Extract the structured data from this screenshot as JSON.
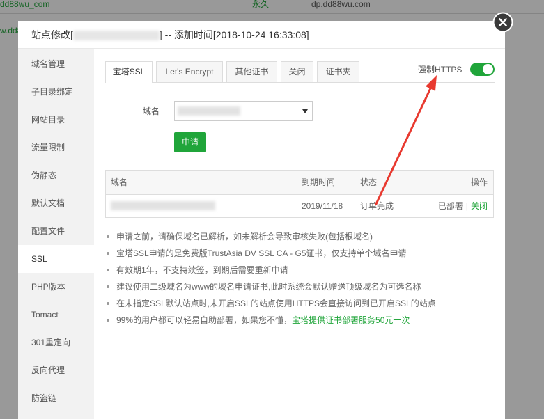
{
  "background_page": {
    "row1": {
      "site": "dd88wu_com",
      "expiry": "永久",
      "domain": "dp.dd88wu.com"
    },
    "row2": {
      "site_fragment": "w.dd8"
    }
  },
  "dialog": {
    "title_prefix": "站点修改[",
    "title_suffix": "] -- 添加时间[2018-10-24 16:33:08]"
  },
  "sidebar": {
    "items": [
      "域名管理",
      "子目录绑定",
      "网站目录",
      "流量限制",
      "伪静态",
      "默认文档",
      "配置文件",
      "SSL",
      "PHP版本",
      "Tomact",
      "301重定向",
      "反向代理",
      "防盗链"
    ],
    "active_index": 7
  },
  "tabs": {
    "items": [
      "宝塔SSL",
      "Let's Encrypt",
      "其他证书",
      "关闭",
      "证书夹"
    ],
    "active_index": 0
  },
  "force_https": {
    "label": "强制HTTPS",
    "enabled": true
  },
  "form": {
    "domain_label": "域名",
    "apply_button": "申请"
  },
  "table": {
    "headers": [
      "域名",
      "到期时间",
      "状态",
      "操作"
    ],
    "rows": [
      {
        "expire_date": "2019/11/18",
        "status": "订单完成",
        "deployed": "已部署",
        "separator": "|",
        "close_action": "关闭"
      }
    ]
  },
  "notes": [
    {
      "text": "申请之前，请确保域名已解析，如未解析会导致审核失败(包括根域名)"
    },
    {
      "text": "宝塔SSL申请的是免费版TrustAsia DV SSL CA - G5证书，仅支持单个域名申请"
    },
    {
      "text": "有效期1年，不支持续签，到期后需要重新申请"
    },
    {
      "text": "建议使用二级域名为www的域名申请证书,此时系统会默认赠送顶级域名为可选名称"
    },
    {
      "text": "在未指定SSL默认站点时,未开启SSL的站点使用HTTPS会直接访问到已开启SSL的站点"
    },
    {
      "text": "99%的用户都可以轻易自助部署，如果您不懂，",
      "link": "宝塔提供证书部署服务50元一次"
    }
  ],
  "colors": {
    "accent": "#20a53a",
    "annotation_arrow": "#e8392f",
    "overlay": "rgba(0,0,0,0.4)"
  },
  "icons": {
    "close": "close-icon",
    "select_caret": "caret-down-icon",
    "annotation": "red-arrow-icon"
  }
}
